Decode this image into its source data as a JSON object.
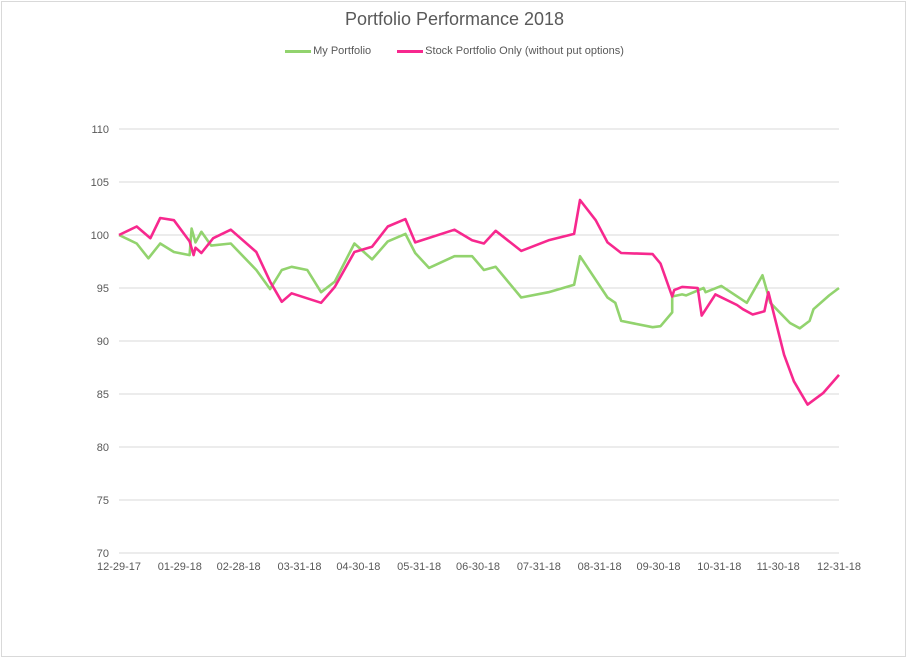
{
  "chart_data": {
    "type": "line",
    "title": "Portfolio Performance 2018",
    "xlabel": "",
    "ylabel": "",
    "ylim": [
      70,
      110
    ],
    "yticks": [
      70,
      75,
      80,
      85,
      90,
      95,
      100,
      105,
      110
    ],
    "xlim": [
      "2017-12-29",
      "2018-12-31"
    ],
    "xticks": [
      {
        "date": "2017-12-29",
        "label": "12-29-17"
      },
      {
        "date": "2018-01-29",
        "label": "01-29-18"
      },
      {
        "date": "2018-02-28",
        "label": "02-28-18"
      },
      {
        "date": "2018-03-31",
        "label": "03-31-18"
      },
      {
        "date": "2018-04-30",
        "label": "04-30-18"
      },
      {
        "date": "2018-05-31",
        "label": "05-31-18"
      },
      {
        "date": "2018-06-30",
        "label": "06-30-18"
      },
      {
        "date": "2018-07-31",
        "label": "07-31-18"
      },
      {
        "date": "2018-08-31",
        "label": "08-31-18"
      },
      {
        "date": "2018-09-30",
        "label": "09-30-18"
      },
      {
        "date": "2018-10-31",
        "label": "10-31-18"
      },
      {
        "date": "2018-11-30",
        "label": "11-30-18"
      },
      {
        "date": "2018-12-31",
        "label": "12-31-18"
      }
    ],
    "grid": "horizontal",
    "legend_position": "top",
    "series": [
      {
        "name": "My Portfolio",
        "color": "#92d36e",
        "points": [
          [
            "2017-12-29",
            100.0
          ],
          [
            "2018-01-07",
            99.2
          ],
          [
            "2018-01-13",
            97.8
          ],
          [
            "2018-01-19",
            99.2
          ],
          [
            "2018-01-26",
            98.4
          ],
          [
            "2018-02-03",
            98.1
          ],
          [
            "2018-02-04",
            100.6
          ],
          [
            "2018-02-06",
            99.3
          ],
          [
            "2018-02-09",
            100.3
          ],
          [
            "2018-02-14",
            99.0
          ],
          [
            "2018-02-24",
            99.2
          ],
          [
            "2018-03-09",
            96.7
          ],
          [
            "2018-03-16",
            94.9
          ],
          [
            "2018-03-22",
            96.7
          ],
          [
            "2018-03-27",
            97.0
          ],
          [
            "2018-04-04",
            96.7
          ],
          [
            "2018-04-11",
            94.6
          ],
          [
            "2018-04-18",
            95.6
          ],
          [
            "2018-04-28",
            99.2
          ],
          [
            "2018-05-07",
            97.7
          ],
          [
            "2018-05-15",
            99.4
          ],
          [
            "2018-05-24",
            100.1
          ],
          [
            "2018-05-29",
            98.3
          ],
          [
            "2018-06-05",
            96.9
          ],
          [
            "2018-06-18",
            98.0
          ],
          [
            "2018-06-27",
            98.0
          ],
          [
            "2018-07-03",
            96.7
          ],
          [
            "2018-07-09",
            97.0
          ],
          [
            "2018-07-22",
            94.1
          ],
          [
            "2018-08-05",
            94.6
          ],
          [
            "2018-08-18",
            95.3
          ],
          [
            "2018-08-21",
            98.0
          ],
          [
            "2018-09-04",
            94.1
          ],
          [
            "2018-09-08",
            93.6
          ],
          [
            "2018-09-11",
            91.9
          ],
          [
            "2018-09-27",
            91.3
          ],
          [
            "2018-10-01",
            91.4
          ],
          [
            "2018-10-07",
            92.7
          ],
          [
            "2018-10-07",
            94.2
          ],
          [
            "2018-10-12",
            94.4
          ],
          [
            "2018-10-14",
            94.3
          ],
          [
            "2018-10-23",
            95.0
          ],
          [
            "2018-10-24",
            94.6
          ],
          [
            "2018-11-01",
            95.2
          ],
          [
            "2018-11-14",
            93.6
          ],
          [
            "2018-11-22",
            96.2
          ],
          [
            "2018-11-26",
            93.6
          ],
          [
            "2018-12-06",
            91.7
          ],
          [
            "2018-12-11",
            91.2
          ],
          [
            "2018-12-16",
            91.9
          ],
          [
            "2018-12-18",
            93.0
          ],
          [
            "2018-12-26",
            94.3
          ],
          [
            "2018-12-31",
            95.0
          ]
        ]
      },
      {
        "name": "Stock Portfolio Only (without put options)",
        "color": "#f7288e",
        "points": [
          [
            "2017-12-29",
            100.0
          ],
          [
            "2018-01-07",
            100.8
          ],
          [
            "2018-01-14",
            99.7
          ],
          [
            "2018-01-19",
            101.6
          ],
          [
            "2018-01-26",
            101.4
          ],
          [
            "2018-02-03",
            99.4
          ],
          [
            "2018-02-05",
            98.1
          ],
          [
            "2018-02-06",
            98.8
          ],
          [
            "2018-02-09",
            98.3
          ],
          [
            "2018-02-15",
            99.7
          ],
          [
            "2018-02-24",
            100.5
          ],
          [
            "2018-03-09",
            98.4
          ],
          [
            "2018-03-16",
            95.6
          ],
          [
            "2018-03-22",
            93.7
          ],
          [
            "2018-03-27",
            94.5
          ],
          [
            "2018-04-11",
            93.6
          ],
          [
            "2018-04-18",
            95.1
          ],
          [
            "2018-04-28",
            98.4
          ],
          [
            "2018-05-07",
            98.9
          ],
          [
            "2018-05-15",
            100.8
          ],
          [
            "2018-05-24",
            101.5
          ],
          [
            "2018-05-29",
            99.3
          ],
          [
            "2018-06-18",
            100.5
          ],
          [
            "2018-06-27",
            99.5
          ],
          [
            "2018-07-03",
            99.2
          ],
          [
            "2018-07-09",
            100.4
          ],
          [
            "2018-07-22",
            98.5
          ],
          [
            "2018-08-05",
            99.5
          ],
          [
            "2018-08-18",
            100.1
          ],
          [
            "2018-08-21",
            103.3
          ],
          [
            "2018-08-29",
            101.4
          ],
          [
            "2018-09-04",
            99.3
          ],
          [
            "2018-09-11",
            98.3
          ],
          [
            "2018-09-27",
            98.2
          ],
          [
            "2018-10-01",
            97.3
          ],
          [
            "2018-10-07",
            94.2
          ],
          [
            "2018-10-08",
            94.8
          ],
          [
            "2018-10-12",
            95.1
          ],
          [
            "2018-10-20",
            95.0
          ],
          [
            "2018-10-22",
            92.4
          ],
          [
            "2018-10-29",
            94.4
          ],
          [
            "2018-11-09",
            93.4
          ],
          [
            "2018-11-12",
            93.0
          ],
          [
            "2018-11-17",
            92.5
          ],
          [
            "2018-11-23",
            92.8
          ],
          [
            "2018-11-25",
            94.6
          ],
          [
            "2018-12-03",
            88.7
          ],
          [
            "2018-12-08",
            86.2
          ],
          [
            "2018-12-15",
            84.0
          ],
          [
            "2018-12-23",
            85.1
          ],
          [
            "2018-12-31",
            86.8
          ]
        ]
      }
    ]
  }
}
